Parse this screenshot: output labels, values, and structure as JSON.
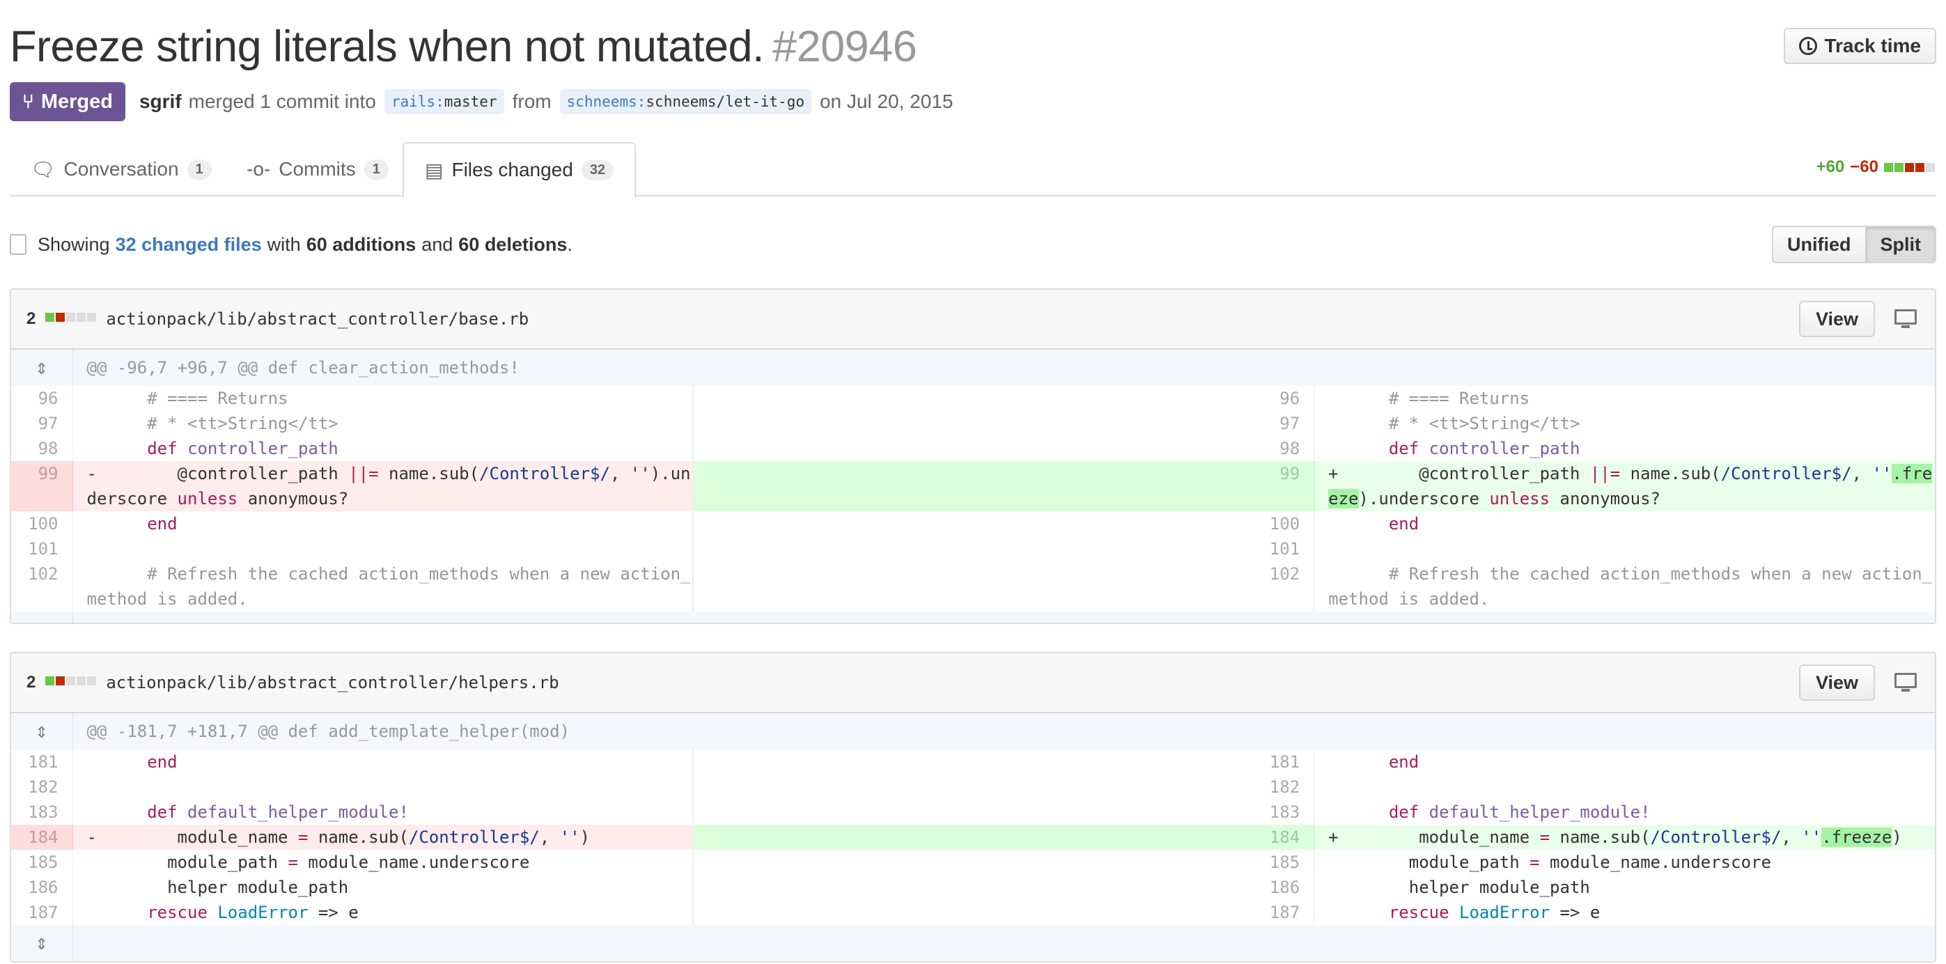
{
  "pr": {
    "title": "Freeze string literals when not mutated.",
    "number": "#20946",
    "status": "Merged",
    "author": "sgrif",
    "action_text": "merged 1 commit into",
    "base_repo": "rails",
    "base_branch": "master",
    "from_text": "from",
    "head_repo": "schneems",
    "head_branch": "schneems/let-it-go",
    "date_text": "on Jul 20, 2015",
    "track_time_label": "Track time"
  },
  "tabs": [
    {
      "label": "Conversation",
      "count": "1"
    },
    {
      "label": "Commits",
      "count": "1"
    },
    {
      "label": "Files changed",
      "count": "32"
    }
  ],
  "diffstat": {
    "additions": "+60",
    "deletions": "−60"
  },
  "summary": {
    "prefix": "Showing",
    "files_link": "32 changed files",
    "with": "with",
    "additions": "60 additions",
    "and": "and",
    "deletions": "60 deletions",
    "suffix": "."
  },
  "view_toggle": {
    "unified": "Unified",
    "split": "Split"
  },
  "files": [
    {
      "changes": "2",
      "path": "actionpack/lib/abstract_controller/base.rb",
      "view_label": "View",
      "hunk": "@@ -96,7 +96,7 @@ def clear_action_methods!",
      "line_numbers": [
        "96",
        "97",
        "98",
        "99",
        "100",
        "101",
        "102"
      ]
    },
    {
      "changes": "2",
      "path": "actionpack/lib/abstract_controller/helpers.rb",
      "view_label": "View",
      "hunk": "@@ -181,7 +181,7 @@ def add_template_helper(mod)",
      "line_numbers": [
        "181",
        "182",
        "183",
        "184",
        "185",
        "186",
        "187"
      ]
    }
  ],
  "colors": {
    "merged": "#6e5494",
    "addition": "#55a532",
    "deletion": "#bd2c00",
    "link": "#4078c0"
  }
}
